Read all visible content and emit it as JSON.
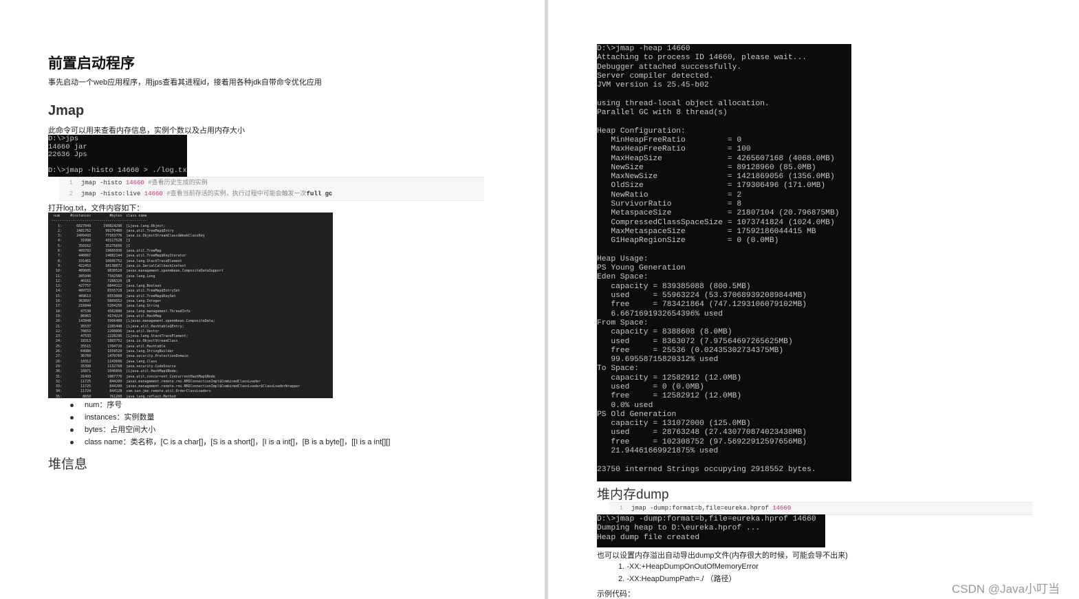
{
  "left": {
    "title": "前置启动程序",
    "intro": "事先启动一个web应用程序，用jps查看其进程id，接着用各种jdk自带命令优化应用",
    "jmap_heading": "Jmap",
    "jmap_desc": "此命令可以用来查看内存信息，实例个数以及占用内存大小",
    "jps_terminal": [
      "D:\\>jps",
      "14660 jar",
      "22636 Jps",
      "",
      "D:\\>jmap -histo 14660 > ./log.txt"
    ],
    "code1": [
      {
        "no": "1",
        "cmd": "jmap -histo ",
        "pid": "14660",
        "comment": " #查看历史生成的实例",
        "tail": ""
      },
      {
        "no": "2",
        "cmd": "jmap -histo:live ",
        "pid": "14660",
        "comment": " #查看当前存活的实例，执行过程中可能会触发一次",
        "tail": "full gc"
      }
    ],
    "open_log": "打开log.txt，文件内容如下：",
    "histo_header": " num     #instances         #bytes  class name",
    "histo_sep": "----------------------------------------------",
    "histo_rows": [
      "   1:       6027049      190824296  [Ljava.lang.Object;",
      "   2:       2481762       99270480  java.util.TreeMap$Entry",
      "   3:       2409493       77103776  java.io.ObjectStreamClass$WeakClassKey",
      "   4:         31998       43117528  [I",
      "   5:        350162       35275656  [C",
      "   6:        409702       19665936  java.util.TreeMap",
      "   7:        440067       14082144  java.util.TreeMap$KeyIterator",
      "   8:        331461       10606752  java.lang.StackTraceElement",
      "   9:        422453       10138872  java.io.SerialCallbackContext",
      "  10:        409605        9830520  javax.management.openmbean.CompositeDataSupport",
      "  11:        305940        7342560  java.lang.Long",
      "  12:         40161        7288320  [B",
      "  13:        427757        6844112  java.lang.Boolean",
      "  14:        409733        6555728  java.util.TreeMap$EntrySet",
      "  15:        409613        6553808  java.util.TreeMap$KeySet",
      "  16:        363097        5809552  java.lang.Integer",
      "  17:        216844        5204256  java.lang.String",
      "  18:         47530        4562880  java.lang.management.ThreadInfo",
      "  19:         86963        4174224  java.util.HashMap",
      "  20:        143948        3966488  [Ljavax.management.openmbean.CompositeData;",
      "  21:         35537        2285448  [Ljava.util.Hashtable$Entry;",
      "  22:         70653        2260896  java.util.Vector",
      "  23:         47533        2228296  [Ljava.lang.StackTraceElement;",
      "  24:         18313        1883752  java.io.ObjectStreamClass",
      "  25:         35515        1704720  java.util.Hashtable",
      "  26:         64980        1559520  java.lang.StringBuilder",
      "  27:         36769        1470760  java.security.ProtectionDomain",
      "  28:         10312        1143696  java.lang.Class",
      "  29:         35399        1132768  java.security.CodeSource",
      "  30:         16871        1046056  [Ljava.util.HashMap$Node;",
      "  31:         31493        1007776  java.util.concurrent.ConcurrentHashMap$Node",
      "  32:         11725         844200  javax.management.remote.rmi.RMIConnectionImpl$CombinedClassLoader",
      "  33:         11725         844200  javax.management.remote.rmi.RMIConnectionImpl$CombinedClassLoader$ClassLoaderWrapper",
      "  34:         11724         844128  com.sun.jmx.remote.util.OrderClassLoaders",
      "  35:          8650         761200  java.lang.reflect.Method"
    ],
    "bullets": [
      "num：序号",
      "instances：实例数量",
      "bytes：占用空间大小",
      "class name：类名称，[C is a char[]，[S is a short[]，[I is a int[]，[B is a byte[]，[[I is a int[][]"
    ],
    "heap_heading": "堆信息"
  },
  "right": {
    "heap_terminal": [
      "D:\\>jmap -heap 14660",
      "Attaching to process ID 14660, please wait...",
      "Debugger attached successfully.",
      "Server compiler detected.",
      "JVM version is 25.45-b02",
      "",
      "using thread-local object allocation.",
      "Parallel GC with 8 thread(s)",
      "",
      "Heap Configuration:",
      "   MinHeapFreeRatio         = 0",
      "   MaxHeapFreeRatio         = 100",
      "   MaxHeapSize              = 4265607168 (4068.0MB)",
      "   NewSize                  = 89128960 (85.0MB)",
      "   MaxNewSize               = 1421869056 (1356.0MB)",
      "   OldSize                  = 179306496 (171.0MB)",
      "   NewRatio                 = 2",
      "   SurvivorRatio            = 8",
      "   MetaspaceSize            = 21807104 (20.796875MB)",
      "   CompressedClassSpaceSize = 1073741824 (1024.0MB)",
      "   MaxMetaspaceSize         = 17592186044415 MB",
      "   G1HeapRegionSize         = 0 (0.0MB)",
      "",
      "Heap Usage:",
      "PS Young Generation",
      "Eden Space:",
      "   capacity = 839385088 (800.5MB)",
      "   used     = 55963224 (53.370689392089844MB)",
      "   free     = 783421864 (747.1293106079102MB)",
      "   6.6671691932654396% used",
      "From Space:",
      "   capacity = 8388608 (8.0MB)",
      "   used     = 8363072 (7.97564697265625MB)",
      "   free     = 25536 (0.02435302734375MB)",
      "   99.69558715820312% used",
      "To Space:",
      "   capacity = 12582912 (12.0MB)",
      "   used     = 0 (0.0MB)",
      "   free     = 12582912 (12.0MB)",
      "   0.0% used",
      "PS Old Generation",
      "   capacity = 131072000 (125.0MB)",
      "   used     = 28763248 (27.430770874023438MB)",
      "   free     = 102308752 (97.56922912597656MB)",
      "   21.94461669921875% used",
      "",
      "23750 interned Strings occupying 2918552 bytes."
    ],
    "dump_heading": "堆内存dump",
    "code2": {
      "no": "1",
      "cmd": "jmap -dump:format=b,file=eureka.hprof ",
      "pid": "14660"
    },
    "dump_terminal": [
      "D:\\>jmap -dump:format=b,file=eureka.hprof 14660",
      "Dumping heap to D:\\eureka.hprof ...",
      "Heap dump file created"
    ],
    "dump_desc": "也可以设置内存溢出自动导出dump文件(内存很大的时候，可能会导不出来)",
    "options": [
      "1. -XX:+HeapDumpOnOutOfMemoryError",
      "2. -XX:HeapDumpPath=./   （路径）"
    ],
    "example": "示例代码："
  },
  "watermark": "CSDN @Java小叮当"
}
